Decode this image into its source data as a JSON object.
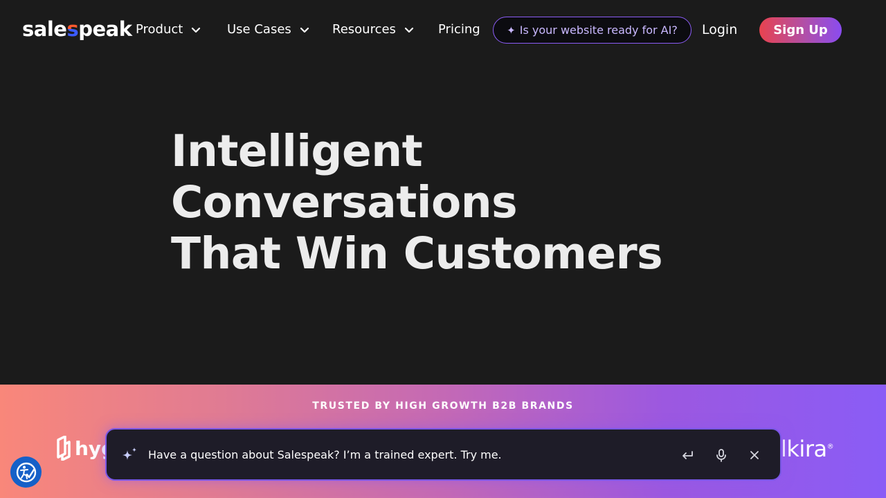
{
  "nav": {
    "logo_text_pre": "sale",
    "logo_text_accent": "s",
    "logo_text_post": "peak",
    "items": [
      {
        "label": "Product",
        "icon": "chevron-down-icon"
      },
      {
        "label": "Use Cases",
        "icon": "chevron-down-icon"
      },
      {
        "label": "Resources",
        "icon": "chevron-down-icon"
      },
      {
        "label": "Pricing"
      }
    ],
    "ai_pill_spark": "✦",
    "ai_pill_label": "Is your website ready for AI?",
    "login_label": "Login",
    "signup_label": "Sign Up"
  },
  "hero": {
    "title_line1": "Intelligent Conversations",
    "title_line2": "That Win Customers"
  },
  "trusted": {
    "label": "TRUSTED BY HIGH GROWTH B2B BRANDS",
    "left_logo_text": "hyg",
    "right_logo_text": "lkira",
    "right_logo_mark": "®"
  },
  "chat": {
    "prompt": "Have a question about Salespeak? I’m a trained expert. Try me.",
    "icons": [
      "sparkle-icon",
      "enter-icon",
      "microphone-icon",
      "close-icon"
    ]
  },
  "colors": {
    "background": "#1b1b1b",
    "accent_purple": "#8b5cf6",
    "signup_gradient_start": "#e8434f",
    "signup_gradient_end": "#8a4cf0",
    "accessibility_blue": "#1660c8"
  }
}
